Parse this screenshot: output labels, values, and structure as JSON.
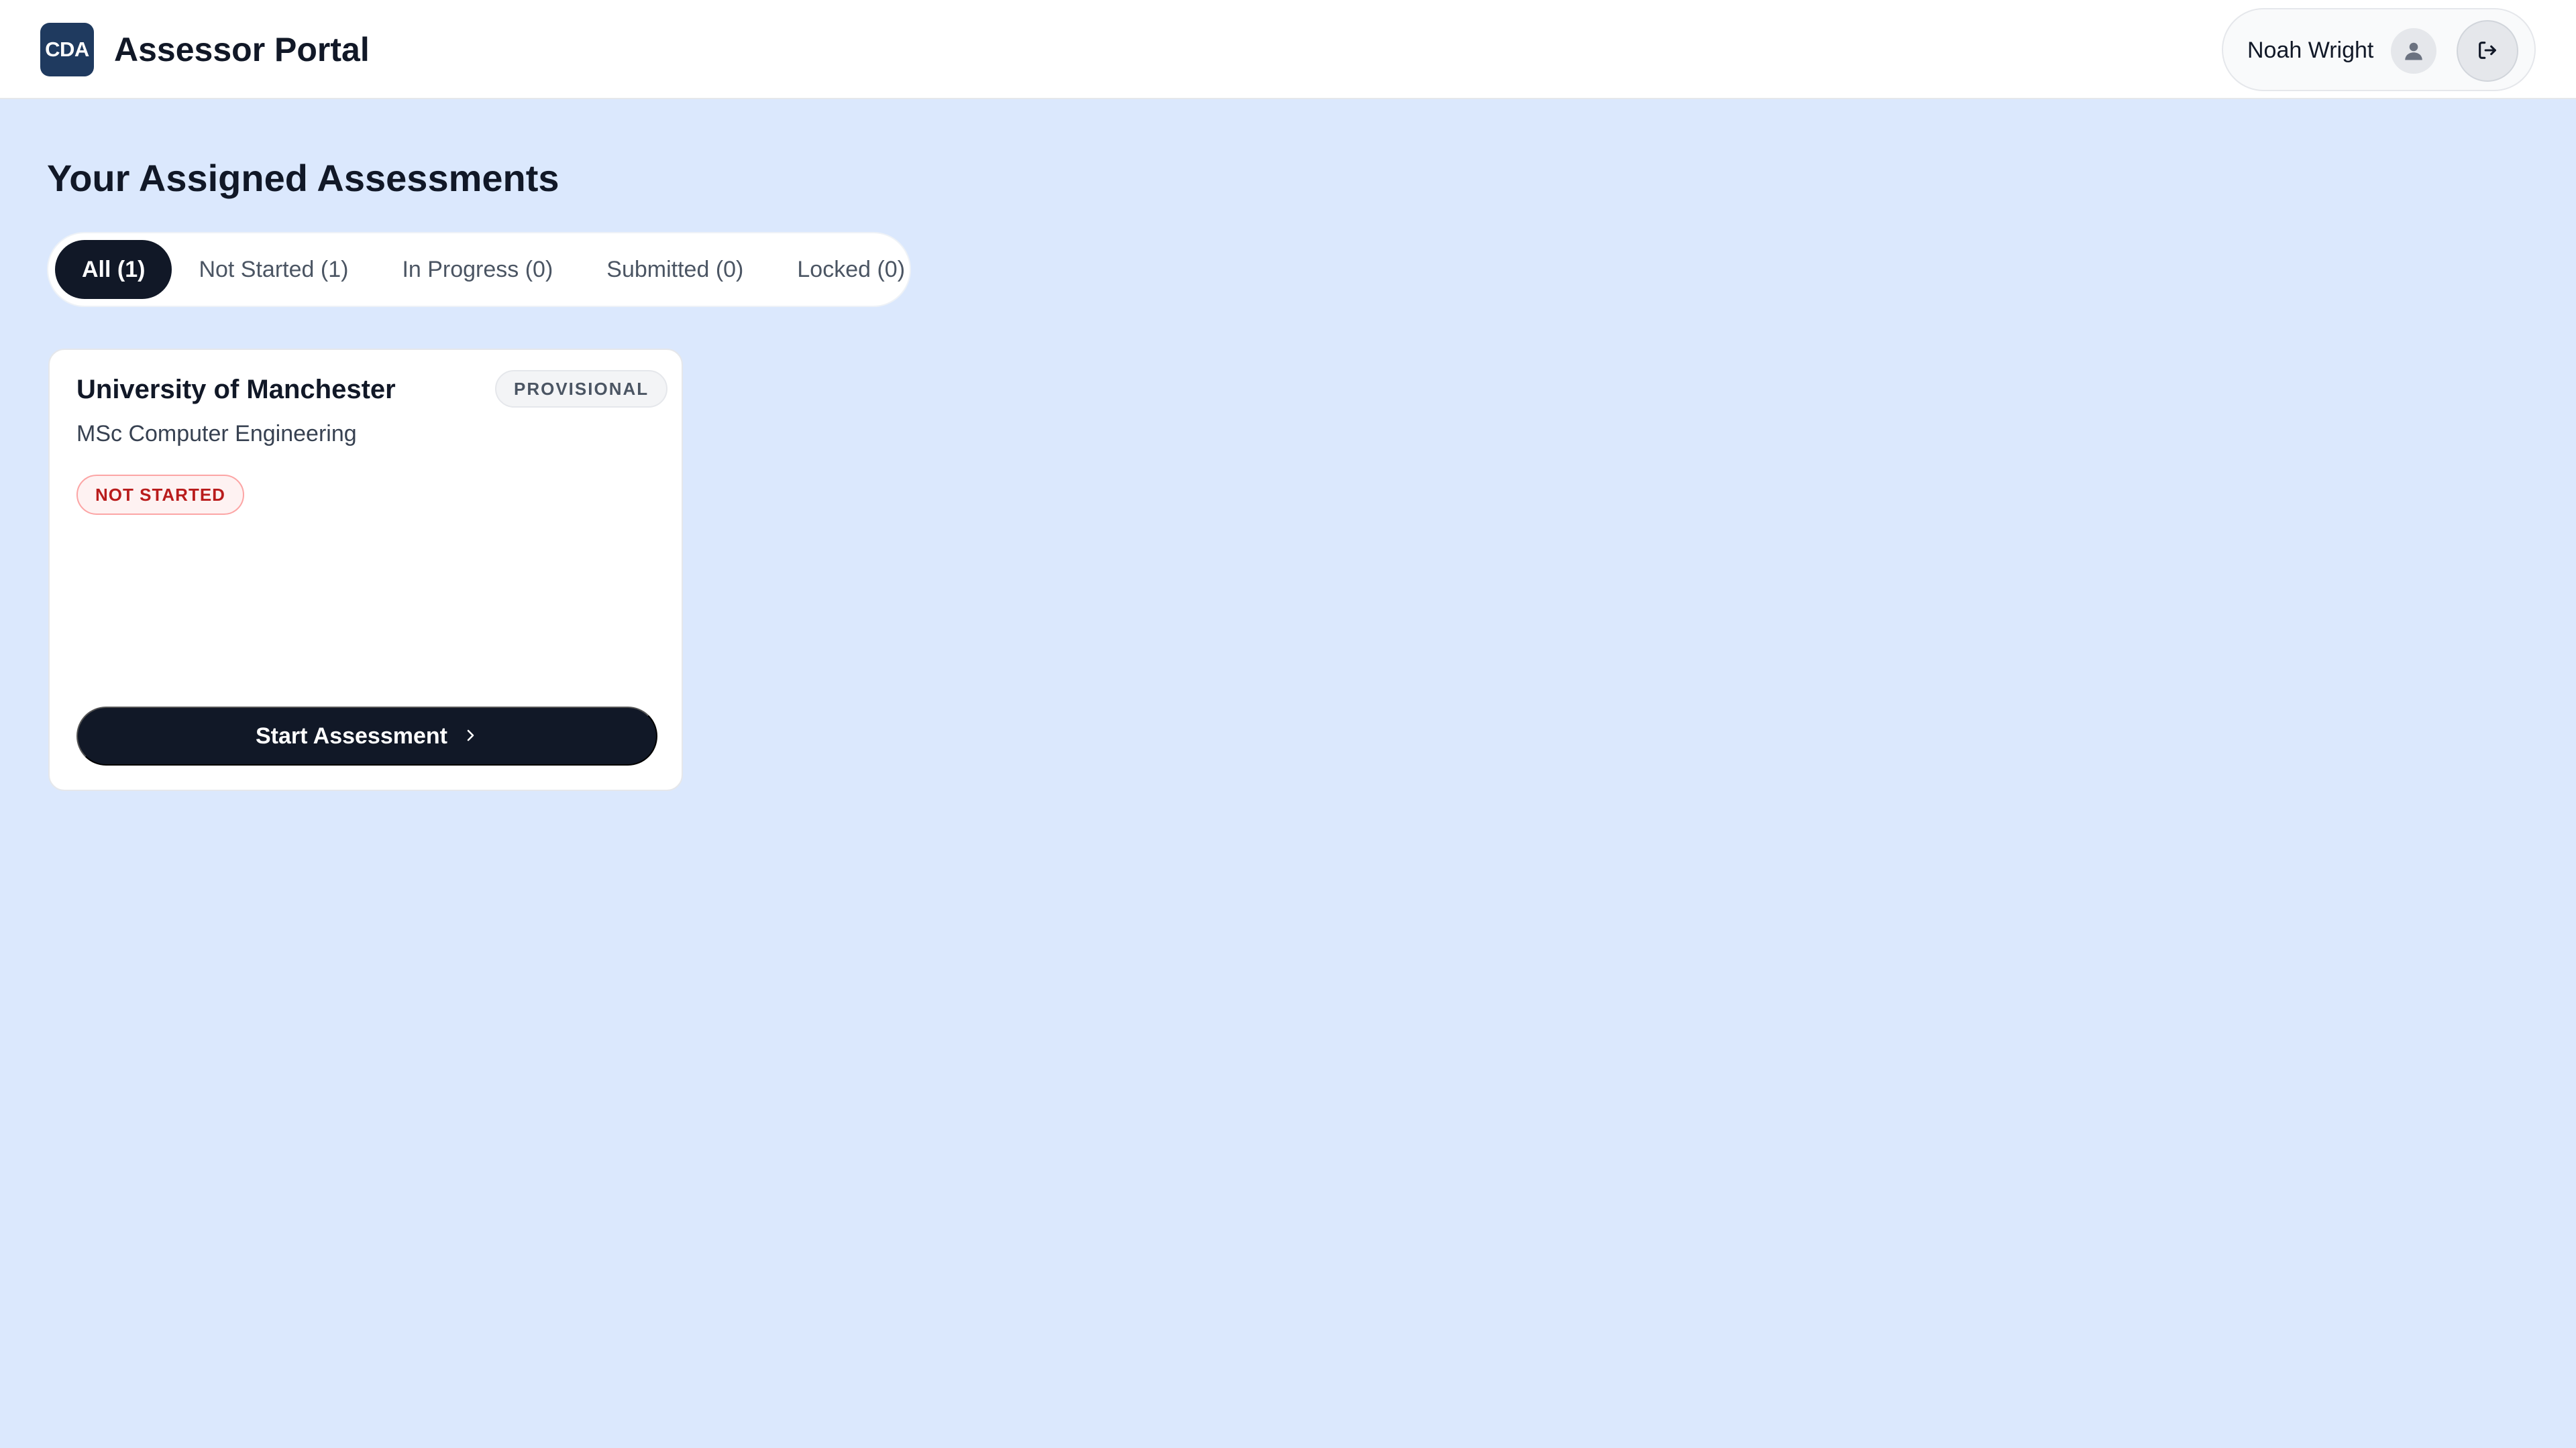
{
  "header": {
    "logo_text": "CDA",
    "title": "Assessor Portal",
    "user_name": "Noah Wright",
    "icons": {
      "avatar": "user-icon",
      "logout": "logout-icon"
    }
  },
  "main": {
    "title": "Your Assigned Assessments",
    "tabs": [
      {
        "label": "All (1)",
        "active": true
      },
      {
        "label": "Not Started (1)",
        "active": false
      },
      {
        "label": "In Progress (0)",
        "active": false
      },
      {
        "label": "Submitted (0)",
        "active": false
      },
      {
        "label": "Locked (0)",
        "active": false
      }
    ],
    "cards": [
      {
        "institution": "University of Manchester",
        "type_badge": "PROVISIONAL",
        "program": "MSc Computer Engineering",
        "status": "NOT STARTED",
        "action_label": "Start Assessment",
        "action_icon": "chevron-right-icon"
      }
    ]
  },
  "colors": {
    "page_background": "#dbe8fd",
    "primary_dark": "#111827",
    "logo_background": "#1f3a5f",
    "status_red": "#b91c1c"
  }
}
